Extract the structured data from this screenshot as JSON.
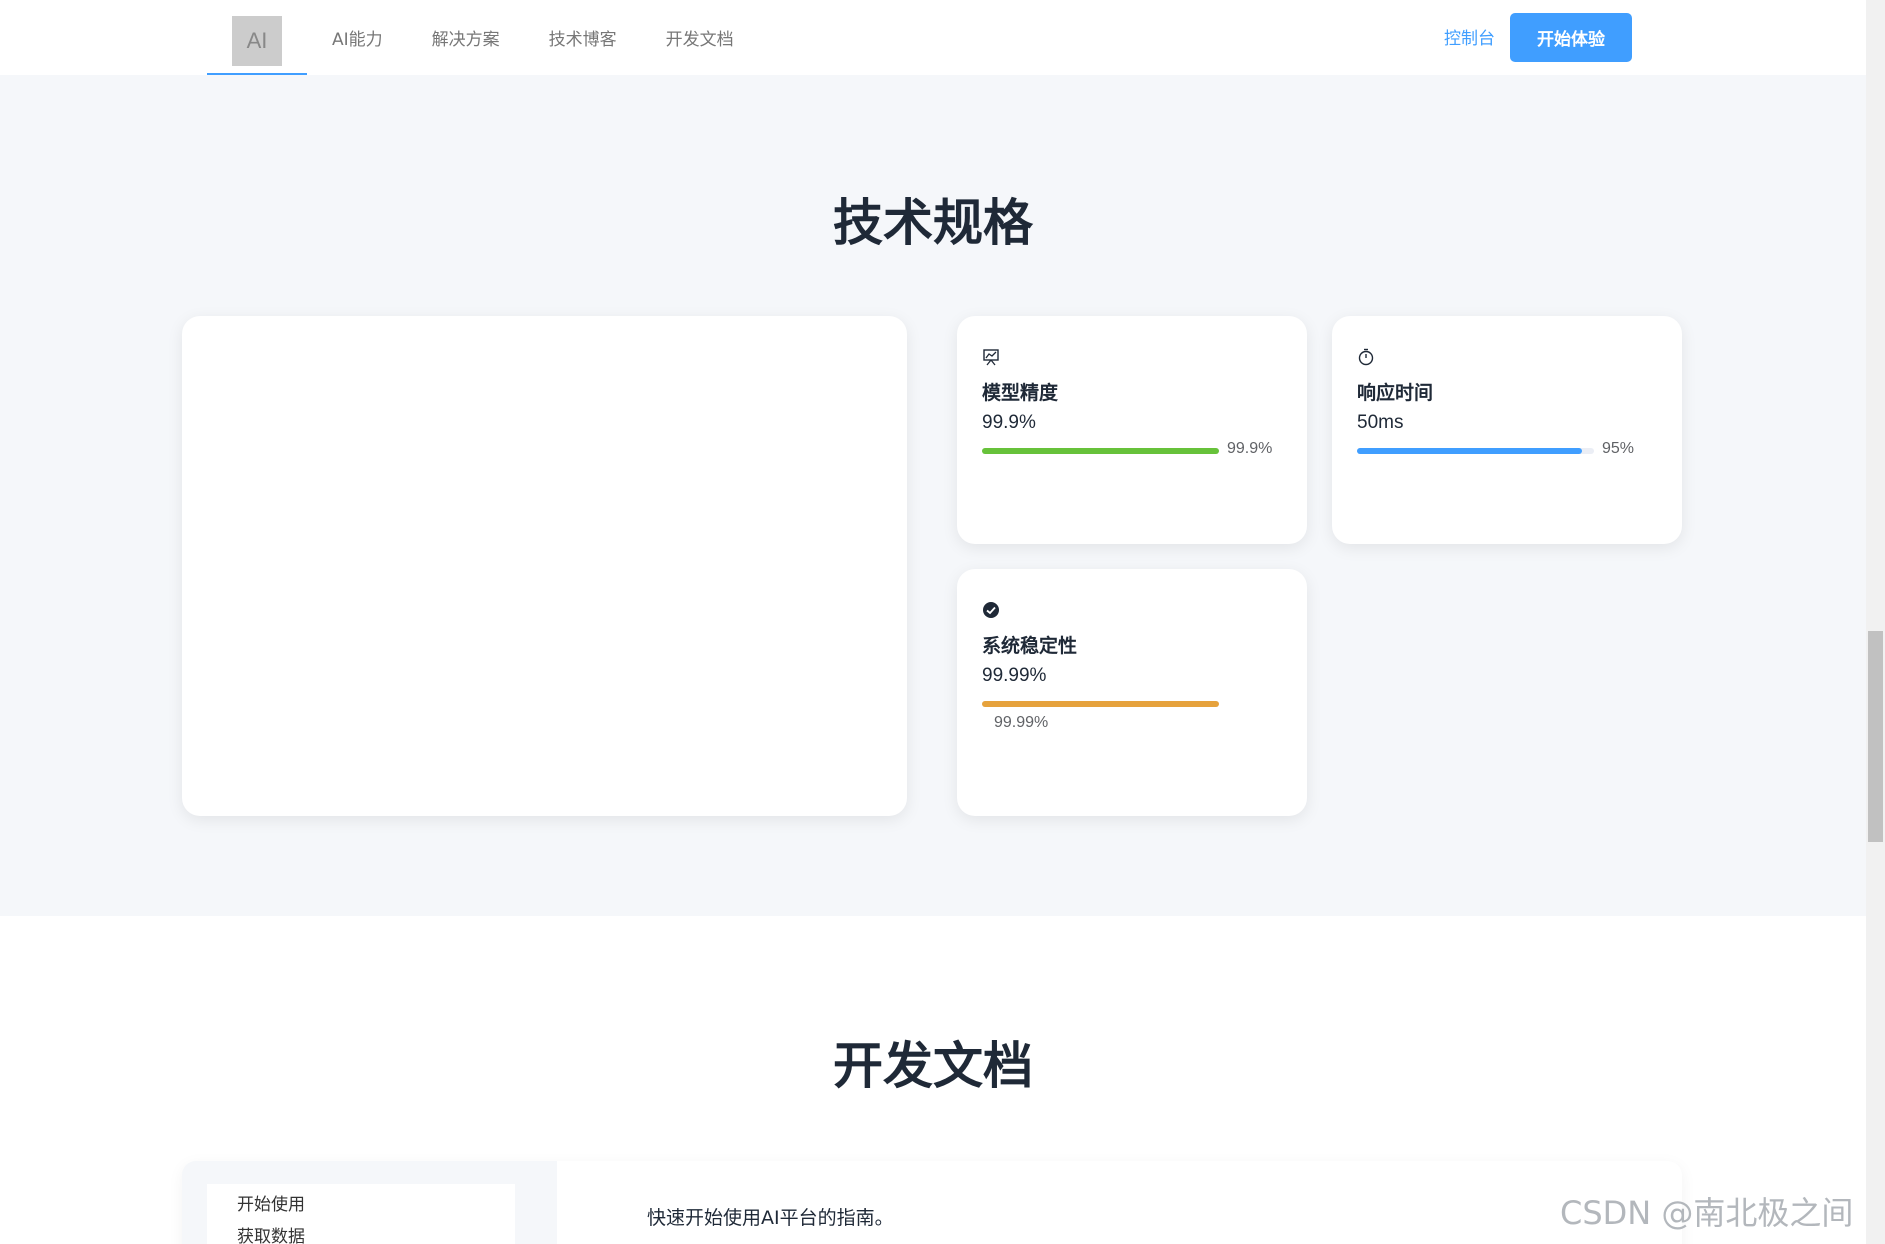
{
  "header": {
    "logo_text": "AI",
    "nav": [
      "AI能力",
      "解决方案",
      "技术博客",
      "开发文档"
    ],
    "console_label": "控制台",
    "start_label": "开始体验"
  },
  "specs": {
    "title": "技术规格",
    "cards": [
      {
        "icon": "presentation-chart-icon",
        "label": "模型精度",
        "value": "99.9%",
        "progress": 99.9,
        "progress_text": "99.9%",
        "color": "#67c23a"
      },
      {
        "icon": "stopwatch-icon",
        "label": "响应时间",
        "value": "50ms",
        "progress": 95,
        "progress_text": "95%",
        "color": "#409eff"
      },
      {
        "icon": "check-circle-icon",
        "label": "系统稳定性",
        "value": "99.99%",
        "progress": 99.99,
        "progress_text": "99.99%",
        "color": "#e6a23c"
      }
    ]
  },
  "docs": {
    "title": "开发文档",
    "sidebar": [
      "开始使用",
      "获取数据"
    ],
    "intro": "快速开始使用AI平台的指南。"
  },
  "watermark": "CSDN @南北极之间"
}
